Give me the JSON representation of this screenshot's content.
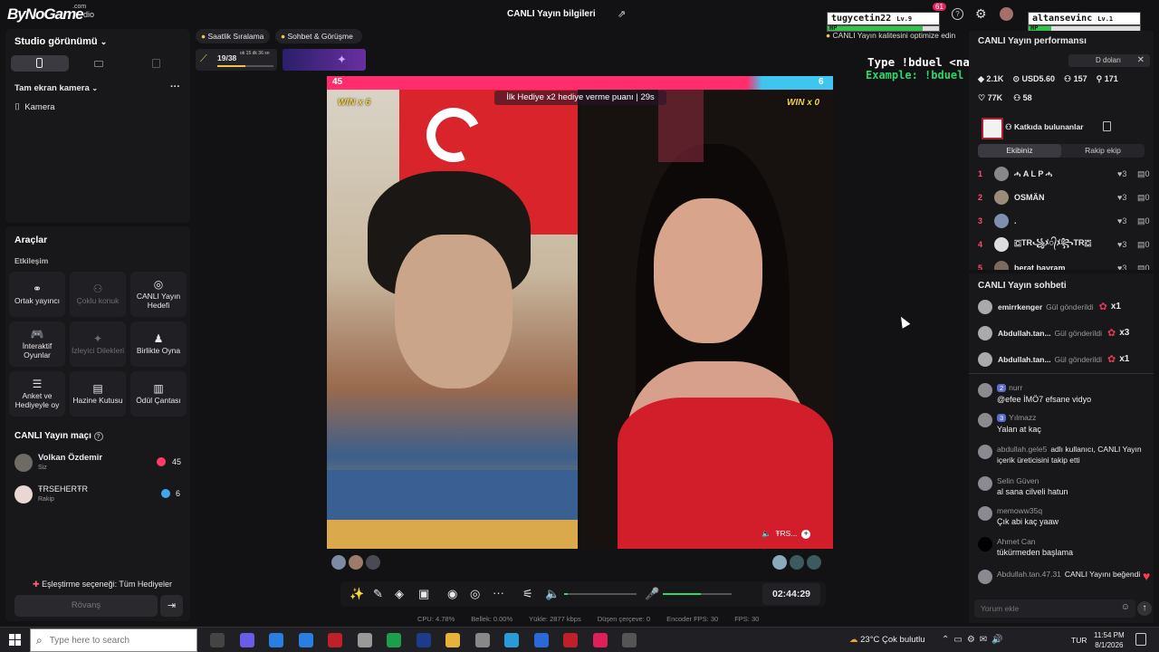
{
  "topbar": {
    "logo": "ByNoGame",
    "logo_sub": ".com",
    "logo_studio": "dio",
    "center_title": "CANLI Yayın bilgileri",
    "notif_count": "61",
    "overlay_left_name": "tugycetin22",
    "overlay_left_level": "Lv.9",
    "overlay_right_name": "altansevinc",
    "overlay_right_level": "Lv.1",
    "hp_label": "HP",
    "hp_left_fraction": 0.85,
    "hp_right_fraction": 0.2
  },
  "left": {
    "studio_view": "Studio görünümü",
    "camera_section": "Tam ekran kamera",
    "camera_item": "Kamera",
    "tools_title": "Araçlar",
    "interaction_label": "Etkileşim",
    "tools": [
      {
        "label": "Ortak yayıncı",
        "icon": "link-icon",
        "dim": false
      },
      {
        "label": "Çoklu konuk",
        "icon": "users-icon",
        "dim": true
      },
      {
        "label": "CANLI Yayın Hedefi",
        "icon": "target-icon",
        "dim": false
      },
      {
        "label": "İnteraktif Oyunlar",
        "icon": "gamepad-icon",
        "dim": false
      },
      {
        "label": "İzleyici Dilekleri",
        "icon": "wish-icon",
        "dim": true
      },
      {
        "label": "Birlikte Oyna",
        "icon": "play-together-icon",
        "dim": false
      },
      {
        "label": "Anket ve Hediyeyle oy",
        "icon": "poll-icon",
        "dim": false
      },
      {
        "label": "Hazine Kutusu",
        "icon": "treasure-icon",
        "dim": false
      },
      {
        "label": "Ödül Çantası",
        "icon": "reward-bag-icon",
        "dim": false
      }
    ],
    "match_title": "CANLI Yayın maçı",
    "match": [
      {
        "name": "Volkan Özdemir",
        "sub": "Siz",
        "score": "45"
      },
      {
        "name": "ŦRSEHERŦR",
        "sub": "Rakip",
        "score": "6"
      }
    ],
    "pairing": "Eşleştirme seçeneği: Tüm Hediyeler",
    "rematch": "Rövanş"
  },
  "main": {
    "pill_ranking": "Saatlik Sıralama",
    "pill_chat": "Sohbet & Görüşme",
    "progress_text": "19/38",
    "progress_fraction": 0.5,
    "progress_timer": "ok 15 dk 36 sn",
    "score_left": "45",
    "score_right": "6",
    "banner": "İlk Hediye x2 hediye verme puanı | 29s",
    "win_left": "WIN x 6",
    "win_right": "WIN x 0",
    "guest_label": "ŦRS...",
    "overlay_type": "Type !bduel <name> to play",
    "overlay_example": "Example: !bduel altansevinc",
    "timer": "02:44:29",
    "stats": [
      "CPU: 4.78%",
      "Bellek: 0.00%",
      "Yükle: 2877 kbps",
      "Düşen çerçeve: 0",
      "Encoder FPS: 30",
      "FPS: 30"
    ],
    "volume_fraction": 0.05,
    "mic_fraction": 0.55
  },
  "right": {
    "quality_tip": "CANLI Yayın kalitesini optimize edin",
    "perf_title": "CANLI Yayın performansı",
    "perf_row1_left": "2.1K",
    "perf_row1_money": "USD5.60",
    "perf_row1_a": "157",
    "perf_row1_b": "171",
    "perf_row2_likes": "77K",
    "perf_row2_b": "58",
    "toast_text": "D doları",
    "contrib_label": "Katkıda bulunanlar",
    "tab_ours": "Ekibiniz",
    "tab_rival": "Rakip ekip",
    "leaderboard": [
      {
        "rank": "1",
        "name": "ሓ A L P ሓ",
        "likes": "3",
        "gifts": "0"
      },
      {
        "rank": "2",
        "name": "OSMÄN",
        "likes": "3",
        "gifts": "0"
      },
      {
        "rank": "3",
        "name": ".",
        "likes": "3",
        "gifts": "0"
      },
      {
        "rank": "4",
        "name": "🇨TR꧁ﾒ᭄ﾒ꧂TR🇨",
        "likes": "3",
        "gifts": "0"
      },
      {
        "rank": "5",
        "name": "berat bayram",
        "likes": "3",
        "gifts": "0"
      }
    ],
    "chat_title": "CANLI Yayın sohbeti",
    "gifts": [
      {
        "user": "emirrkenger",
        "text": "Gül gönderildi",
        "count": "x1"
      },
      {
        "user": "Abdullah.tan...",
        "text": "Gül gönderildi",
        "count": "x3"
      },
      {
        "user": "Abdullah.tan...",
        "text": "Gül gönderildi",
        "count": "x1"
      }
    ],
    "chat": [
      {
        "badge": "2",
        "user": "nurr",
        "msg": "@efee İMÖ7 efsane vidyo"
      },
      {
        "badge": "3",
        "user": "Yılmazz",
        "msg": "Yalan at kaç"
      },
      {
        "badge": "",
        "user": "abdullah.gele5",
        "msg": "adlı kullanıcı, CANLI Yayın içerik üreticisini takip etti"
      },
      {
        "badge": "",
        "user": "Selin Güven",
        "msg": "al sana cilveli hatun"
      },
      {
        "badge": "",
        "user": "memoww35q",
        "msg": "Çık abi kaç yaaw"
      },
      {
        "badge": "",
        "user": "Ahmet Can",
        "msg": "tükürmeden başlama"
      },
      {
        "badge": "",
        "user": "Abdullah.tan.47.31",
        "msg": "CANLI Yayını beğendi"
      }
    ],
    "comment_placeholder": "Yorum ekle"
  },
  "taskbar": {
    "search_placeholder": "Type here to search",
    "weather_temp": "23°C",
    "weather_desc": "Çok bulutlu",
    "lang": "TUR",
    "time": "11:54 PM",
    "date": "8/1/2026"
  },
  "colors": {
    "accent_pink": "#ff2c6e",
    "accent_blue": "#3ec6f0",
    "green": "#2fd46b",
    "heart": "#ff3b4b"
  }
}
